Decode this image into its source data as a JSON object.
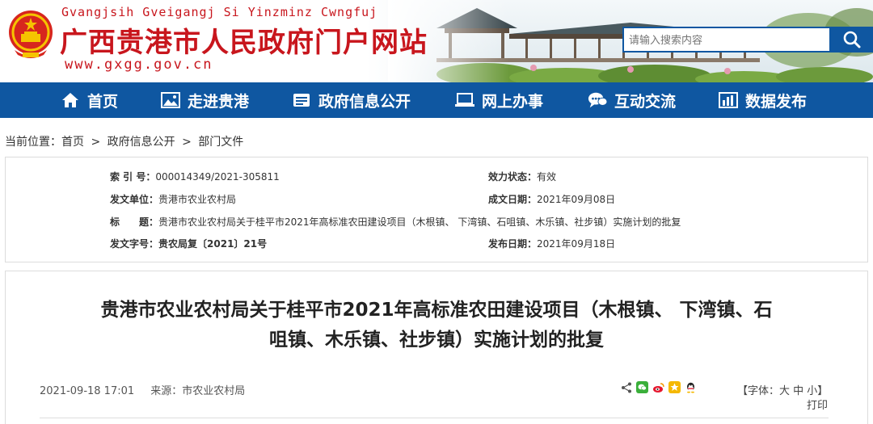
{
  "header": {
    "pinyin": "Gvangjsih Gveigangj Si Yinzminz Cwngfuj",
    "title": "广西贵港市人民政府门户网站",
    "url": "www.gxgg.gov.cn"
  },
  "search": {
    "placeholder": "请输入搜索内容"
  },
  "nav": {
    "items": [
      {
        "label": "首页",
        "icon": "home-icon"
      },
      {
        "label": "走进贵港",
        "icon": "picture-icon"
      },
      {
        "label": "政府信息公开",
        "icon": "document-icon"
      },
      {
        "label": "网上办事",
        "icon": "laptop-icon"
      },
      {
        "label": "互动交流",
        "icon": "chat-icon"
      },
      {
        "label": "数据发布",
        "icon": "bar-chart-icon"
      }
    ]
  },
  "breadcrumb": {
    "prefix": "当前位置：",
    "items": [
      "首页",
      "政府信息公开",
      "部门文件"
    ],
    "separator": ">"
  },
  "meta": {
    "index_label": "索 引 号：",
    "index_value": "000014349/2021-305811",
    "validity_label": "效力状态：",
    "validity_value": "有效",
    "issuer_label": "发文单位：",
    "issuer_value": "贵港市农业农村局",
    "created_label": "成文日期：",
    "created_value": "2021年09月08日",
    "title_label": "标　　题：",
    "title_value": "贵港市农业农村局关于桂平市2021年高标准农田建设项目（木根镇、 下湾镇、石咀镇、木乐镇、社步镇）实施计划的批复",
    "docno_label": "发文字号：",
    "docno_value": "贵农局复〔2021〕21号",
    "published_label": "发布日期：",
    "published_value": "2021年09月18日"
  },
  "article": {
    "title_line1": "贵港市农业农村局关于桂平市2021年高标准农田建设项目（木根镇、 下湾镇、石",
    "title_line2": "咀镇、木乐镇、社步镇）实施计划的批复",
    "datetime": "2021-09-18 17:01",
    "source": "来源：市农业农村局",
    "font_size_label": "【字体：大 中 小】",
    "print_label": "打印"
  },
  "colors": {
    "primary_blue": "#0f57a1",
    "brand_red": "#c8161d"
  }
}
